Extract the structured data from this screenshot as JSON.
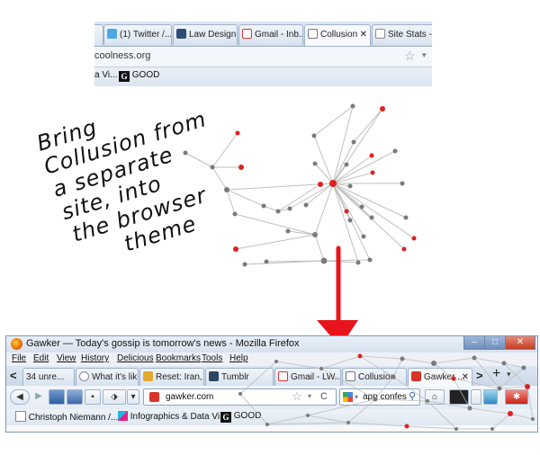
{
  "top_browser": {
    "tabs": [
      {
        "label": "",
        "icon": "tab-edge"
      },
      {
        "label": "(1) Twitter /...",
        "icon": "twitter-icon"
      },
      {
        "label": "Law Design ...",
        "icon": "law-design-icon"
      },
      {
        "label": "Gmail - Inb...",
        "icon": "gmail-icon"
      },
      {
        "label": "Collusion",
        "icon": "collusion-icon",
        "close": "✕"
      },
      {
        "label": "Site Stats - R...",
        "icon": "page-icon"
      }
    ],
    "url": "coolness.org",
    "bookmarks": [
      "a Vi...",
      "GOOD"
    ],
    "bookmark_badge": "G"
  },
  "annotation": {
    "lines": [
      "Bring",
      "Collusion from",
      "a separate",
      "site, into",
      "the browser",
      "theme"
    ]
  },
  "bottom_browser": {
    "window_title": "Gawker — Today's gossip is tomorrow's news - Mozilla Firefox",
    "menu": [
      "File",
      "Edit",
      "View",
      "History",
      "Delicious",
      "Bookmarks",
      "Tools",
      "Help"
    ],
    "tabs": [
      {
        "label": "34 unre...",
        "icon": "mail-icon"
      },
      {
        "label": "What it's lik...",
        "icon": "page-icon"
      },
      {
        "label": "Reset: Iran, ...",
        "icon": "reset-icon"
      },
      {
        "label": "Tumblr",
        "icon": "tumblr-icon"
      },
      {
        "label": "Gmail - LW...",
        "icon": "gmail-icon"
      },
      {
        "label": "Collusion",
        "icon": "collusion-icon"
      },
      {
        "label": "Gawker ...",
        "icon": "gawker-icon",
        "close": "✕"
      }
    ],
    "tab_back": "<",
    "tab_forward": ">",
    "new_tab": "+",
    "url": "gawker.com",
    "search_value": "app confes",
    "bookmarks": [
      "Christoph Niemann /...",
      "Infographics & Data Vi...",
      "GOOD"
    ],
    "bookmark_badge": "G",
    "window_buttons": {
      "minimize": "–",
      "maximize": "□",
      "close": "✕"
    },
    "reload": "C"
  },
  "colors": {
    "node_red": "#e02020",
    "node_grey": "#7a7a7a",
    "edge": "#b9b9b9",
    "arrow": "#e8141b",
    "chrome_blue": "#c9d7e8"
  }
}
